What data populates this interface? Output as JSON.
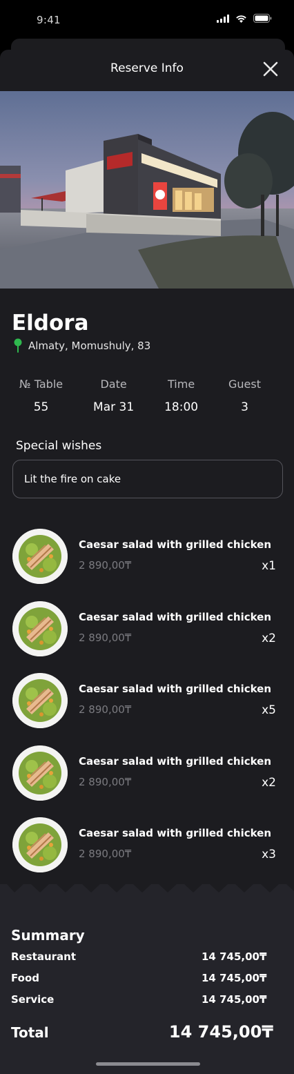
{
  "status": {
    "time": "9:41"
  },
  "header": {
    "title": "Reserve Info"
  },
  "restaurant": {
    "name": "Eldora",
    "address": "Almaty, Momushuly, 83"
  },
  "reservation": {
    "columns": [
      {
        "label": "№ Table",
        "value": "55"
      },
      {
        "label": "Date",
        "value": "Mar 31"
      },
      {
        "label": "Time",
        "value": "18:00"
      },
      {
        "label": "Guest",
        "value": "3"
      }
    ]
  },
  "wishes": {
    "label": "Special wishes",
    "value": "Lit the fire on cake"
  },
  "orders": [
    {
      "name": "Caesar salad with grilled chicken",
      "price": "2 890,00₸",
      "qty": "x1"
    },
    {
      "name": "Caesar salad with grilled chicken",
      "price": "2 890,00₸",
      "qty": "x2"
    },
    {
      "name": "Caesar salad with grilled chicken",
      "price": "2 890,00₸",
      "qty": "x5"
    },
    {
      "name": "Caesar salad with grilled chicken",
      "price": "2 890,00₸",
      "qty": "x2"
    },
    {
      "name": "Caesar salad with grilled chicken",
      "price": "2 890,00₸",
      "qty": "x3"
    }
  ],
  "summary": {
    "title": "Summary",
    "rows": [
      {
        "label": "Restaurant",
        "value": "14 745,00₸"
      },
      {
        "label": "Food",
        "value": "14 745,00₸"
      },
      {
        "label": "Service",
        "value": "14 745,00₸"
      }
    ],
    "total_label": "Total",
    "total_value": "14 745,00₸"
  },
  "colors": {
    "sheet_bg": "#1c1c20",
    "summary_bg": "#24242a",
    "pin": "#2fb84e",
    "price_muted": "#7b7b80"
  },
  "icons": [
    "signal-icon",
    "wifi-icon",
    "battery-icon",
    "close-icon",
    "location-pin-icon"
  ]
}
